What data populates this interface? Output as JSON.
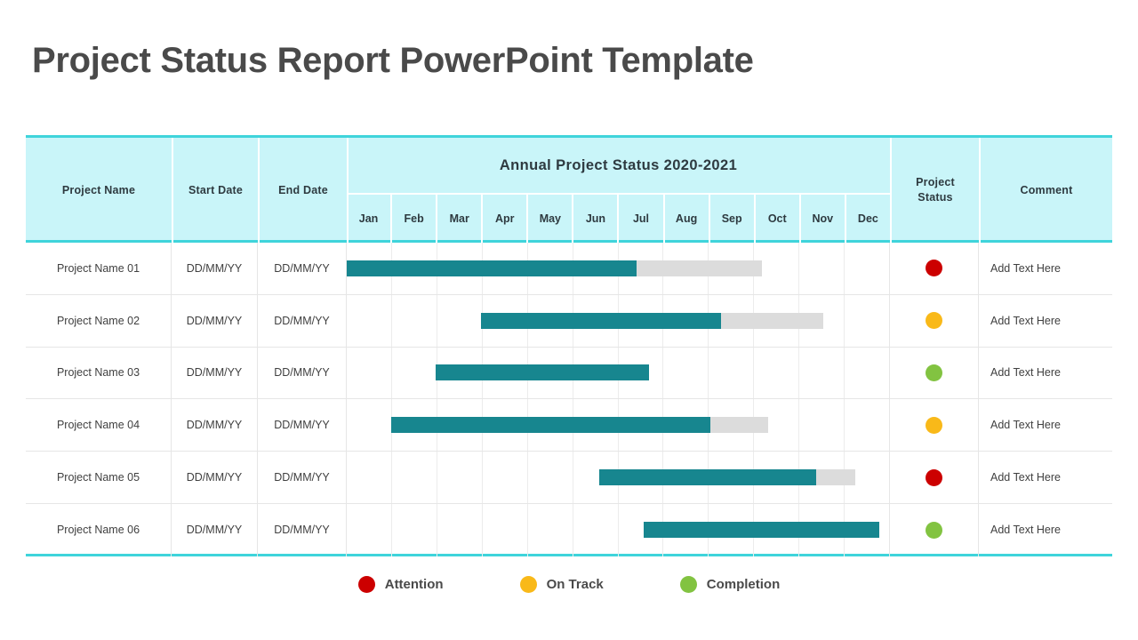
{
  "slide": {
    "title": "Project Status Report PowerPoint Template"
  },
  "colors": {
    "header_bg": "#C9F5F9",
    "header_border": "#3FD4DB",
    "bar_done": "#17868F",
    "bar_remaining": "#DCDCDC",
    "status_attention": "#CC0000",
    "status_on_track": "#F9B919",
    "status_completion": "#82C341",
    "title_text": "#4A4A4A",
    "grid_line": "#E6E6E6"
  },
  "table": {
    "headers": {
      "project_name": "Project Name",
      "start_date": "Start Date",
      "end_date": "End Date",
      "annual_band": "Annual Project Status 2020-2021",
      "project_status": "Project\nStatus",
      "project_status_line1": "Project",
      "project_status_line2": "Status",
      "comment": "Comment"
    },
    "months": [
      "Jan",
      "Feb",
      "Mar",
      "Apr",
      "May",
      "Jun",
      "Jul",
      "Aug",
      "Sep",
      "Oct",
      "Nov",
      "Dec"
    ],
    "rows": [
      {
        "name": "Project Name 01",
        "start_date": "DD/MM/YY",
        "end_date": "DD/MM/YY",
        "status": "attention",
        "status_color": "#CC0000",
        "comment": "Add Text Here",
        "bar_start_pct": 0.0,
        "bar_done_pct": 53.5,
        "bar_total_pct": 76.5
      },
      {
        "name": "Project Name 02",
        "start_date": "DD/MM/YY",
        "end_date": "DD/MM/YY",
        "status": "on-track",
        "status_color": "#F9B919",
        "comment": "Add Text Here",
        "bar_start_pct": 24.7,
        "bar_done_pct": 44.3,
        "bar_total_pct": 63.2
      },
      {
        "name": "Project Name 03",
        "start_date": "DD/MM/YY",
        "end_date": "DD/MM/YY",
        "status": "completion",
        "status_color": "#82C341",
        "comment": "Add Text Here",
        "bar_start_pct": 16.4,
        "bar_done_pct": 39.3,
        "bar_total_pct": 39.3
      },
      {
        "name": "Project Name 04",
        "start_date": "DD/MM/YY",
        "end_date": "DD/MM/YY",
        "status": "on-track",
        "status_color": "#F9B919",
        "comment": "Add Text Here",
        "bar_start_pct": 8.2,
        "bar_done_pct": 58.8,
        "bar_total_pct": 69.5
      },
      {
        "name": "Project Name 05",
        "start_date": "DD/MM/YY",
        "end_date": "DD/MM/YY",
        "status": "attention",
        "status_color": "#CC0000",
        "comment": "Add Text Here",
        "bar_start_pct": 46.5,
        "bar_done_pct": 40.1,
        "bar_total_pct": 47.3
      },
      {
        "name": "Project Name 06",
        "start_date": "DD/MM/YY",
        "end_date": "DD/MM/YY",
        "status": "completion",
        "status_color": "#82C341",
        "comment": "Add Text Here",
        "bar_start_pct": 54.7,
        "bar_done_pct": 43.5,
        "bar_total_pct": 43.5
      }
    ]
  },
  "legend": [
    {
      "label": "Attention",
      "color": "#CC0000"
    },
    {
      "label": "On Track",
      "color": "#F9B919"
    },
    {
      "label": "Completion",
      "color": "#82C341"
    }
  ]
}
